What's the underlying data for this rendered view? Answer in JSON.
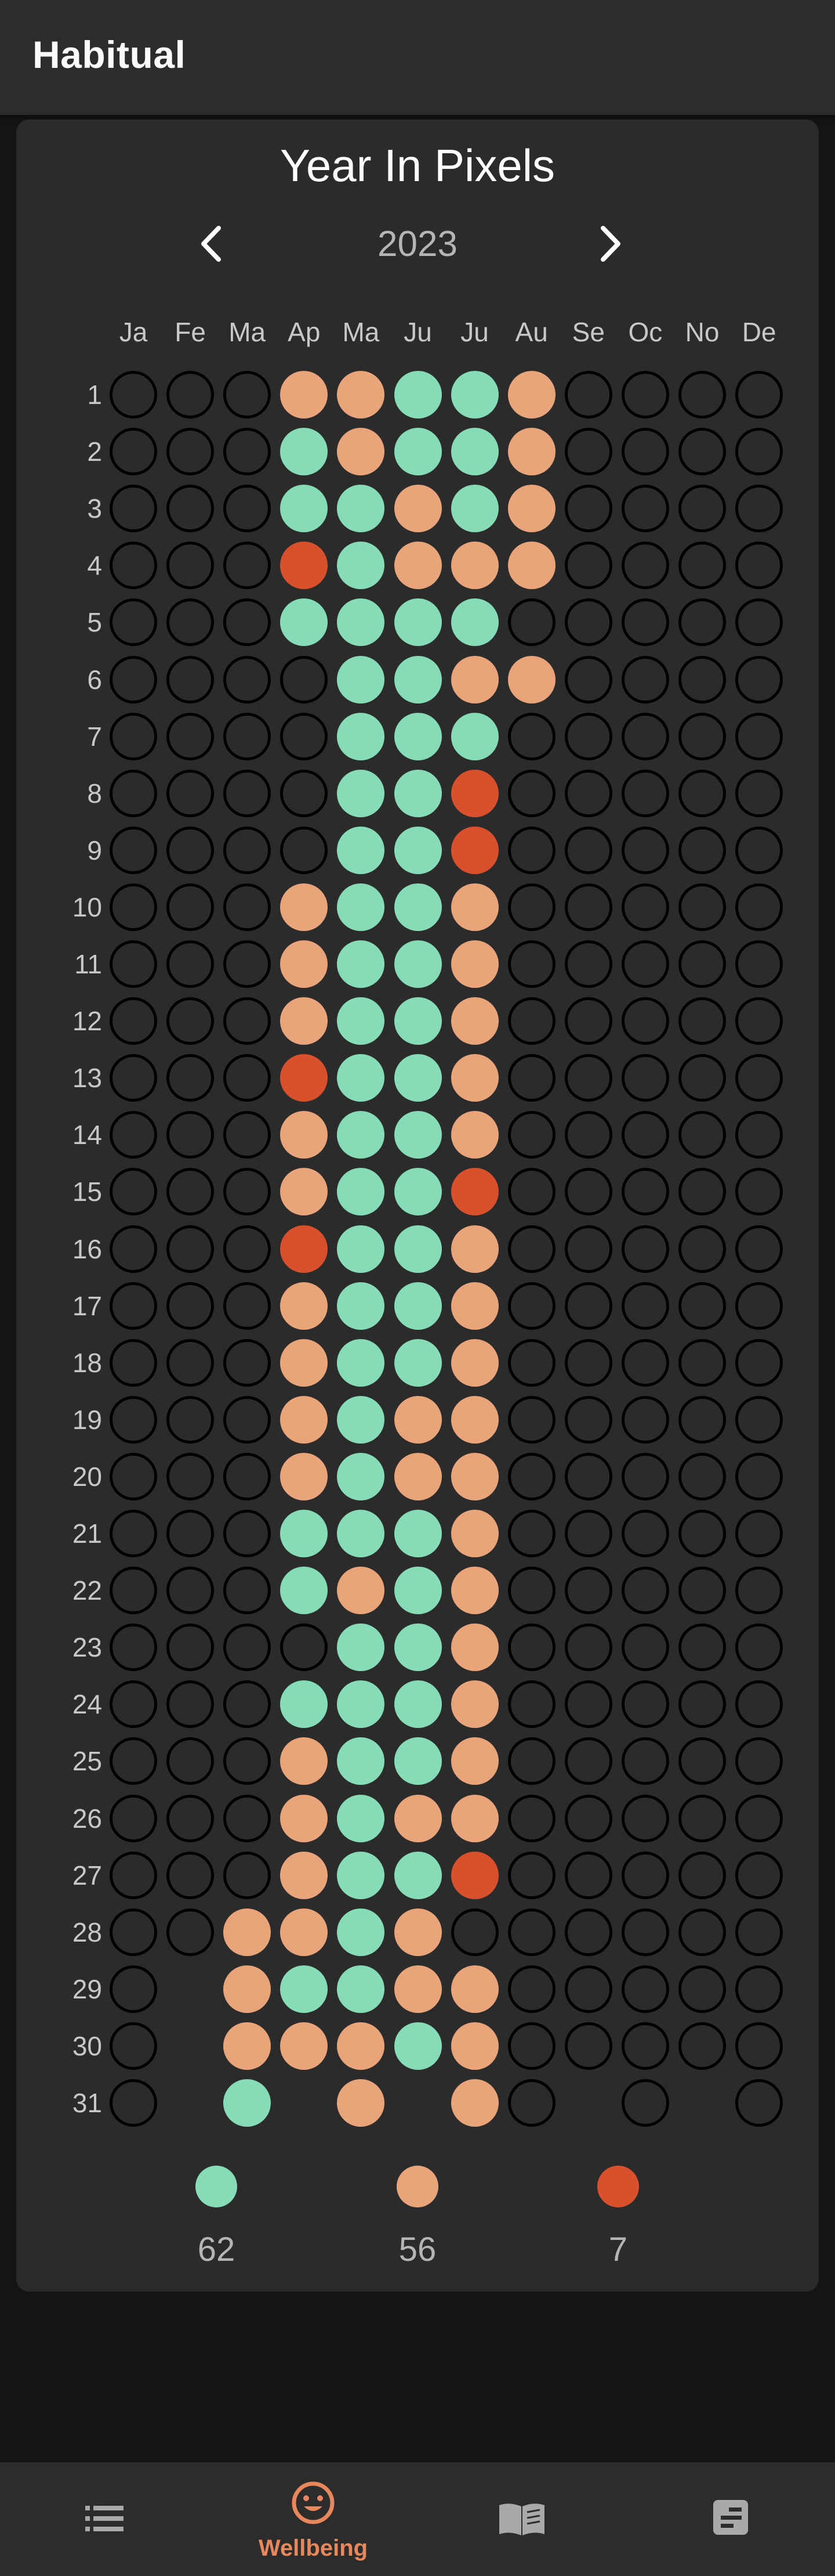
{
  "app": {
    "title": "Habitual"
  },
  "pixels": {
    "title": "Year In Pixels",
    "year": "2023",
    "months": [
      "Ja",
      "Fe",
      "Ma",
      "Ap",
      "Ma",
      "Ju",
      "Ju",
      "Au",
      "Se",
      "Oc",
      "No",
      "De"
    ],
    "days": [
      "1",
      "2",
      "3",
      "4",
      "5",
      "6",
      "7",
      "8",
      "9",
      "10",
      "11",
      "12",
      "13",
      "14",
      "15",
      "16",
      "17",
      "18",
      "19",
      "20",
      "21",
      "22",
      "23",
      "24",
      "25",
      "26",
      "27",
      "28",
      "29",
      "30",
      "31"
    ],
    "month_columns": [
      "EEEEEEEEEEEEEEEEEEEEEEEEEEEEEEE",
      "EEEEEEEEEEEEEEEEEEEEEEEEEEEE",
      "EEEEEEEEEEEEEEEEEEEEEEEEEEEPPPG",
      "PGGRGEEEEPPPRPPRPPPPGGEGPPPPGP",
      "PPGGGGGGGGGGGGGGGGGGGPGGGGGGGPP",
      "GGPPGGGGGGGGGGGGGGPPGGGGGPGPPG",
      "GGGPGPGRRPPPPPRPPPPPPPPPPPREPPP",
      "PPPPEPEEEEEEEEEEEEEEEEEEEEEEEEE",
      "EEEEEEEEEEEEEEEEEEEEEEEEEEEEEE",
      "EEEEEEEEEEEEEEEEEEEEEEEEEEEEEEE",
      "EEEEEEEEEEEEEEEEEEEEEEEEEEEEEE",
      "EEEEEEEEEEEEEEEEEEEEEEEEEEEEEEE"
    ],
    "cell_key": {
      "E": "empty",
      "G": "green",
      "P": "peach",
      "R": "red"
    }
  },
  "colors": {
    "green": "#86dcb7",
    "peach": "#eaa47a",
    "red": "#d9502d",
    "accent": "#e8875c",
    "icon_gray": "#a9a9a9"
  },
  "legend": [
    {
      "color": "green",
      "count": "62"
    },
    {
      "color": "peach",
      "count": "56"
    },
    {
      "color": "red",
      "count": "7"
    }
  ],
  "bottom_nav": {
    "habits_icon": "list-icon",
    "wellbeing_label": "Wellbeing",
    "wellbeing_icon": "smiley-icon",
    "journal_icon": "book-icon",
    "notes_icon": "notes-icon"
  }
}
